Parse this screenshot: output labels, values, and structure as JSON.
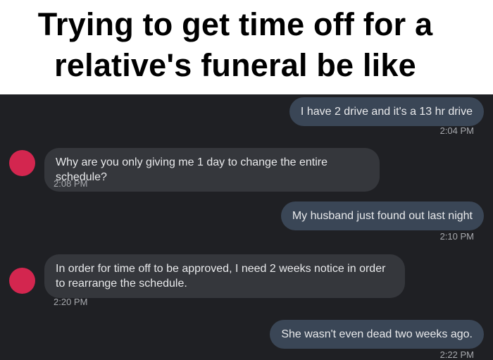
{
  "caption": {
    "line1": "Trying to get time off for a",
    "line2": "relative's funeral be like"
  },
  "messages": [
    {
      "direction": "sent",
      "text": "I have 2 drive and it's a 13 hr drive",
      "time": "2:04 PM"
    },
    {
      "direction": "received",
      "text": "Why are you only giving me 1 day to change the entire schedule?",
      "time": "2:08 PM"
    },
    {
      "direction": "sent",
      "text": "My husband just found out last night",
      "time": "2:10 PM"
    },
    {
      "direction": "received",
      "text": "In order for time off to be approved, I need 2 weeks notice in order to rearrange the schedule.",
      "time": "2:20 PM"
    },
    {
      "direction": "sent",
      "text": "She wasn't even dead two weeks ago.",
      "time": "2:22 PM"
    }
  ],
  "colors": {
    "background": "#1f2024",
    "sent_bubble": "#3a4656",
    "received_bubble": "#35373c",
    "avatar": "#d3264f",
    "timestamp": "#a7a9ae"
  }
}
